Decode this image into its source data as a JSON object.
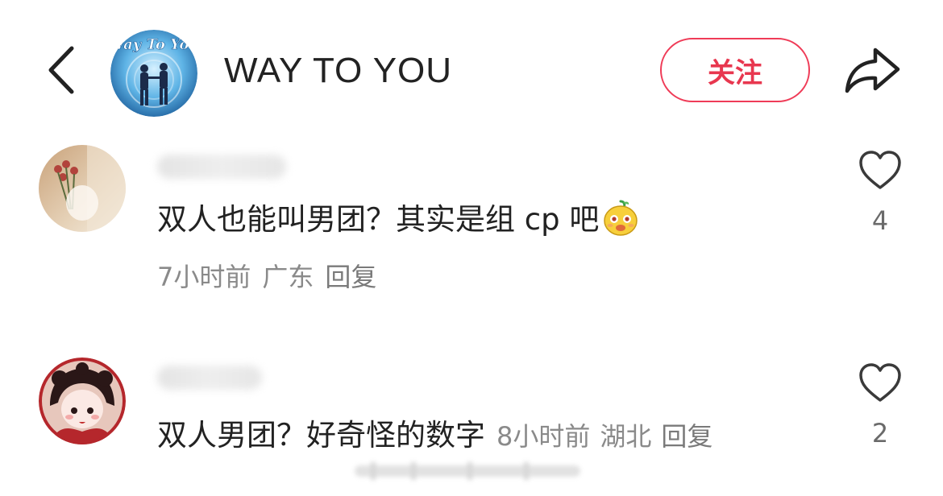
{
  "header": {
    "page_title": "WAY TO YOU",
    "follow_label": "关注",
    "avatar_text": "Way To You"
  },
  "comments": [
    {
      "text": "双人也能叫男团？其实是组 cp 吧",
      "time": "7小时前",
      "location": "广东",
      "reply_label": "回复",
      "likes": "4"
    },
    {
      "text": "双人男团？好奇怪的数字",
      "time": "8小时前",
      "location": "湖北",
      "reply_label": "回复",
      "likes": "2"
    }
  ],
  "colors": {
    "accent": "#e8374f",
    "meta_text": "#8a8a8a"
  },
  "icons": [
    "back-arrow-icon",
    "share-icon",
    "heart-icon"
  ]
}
